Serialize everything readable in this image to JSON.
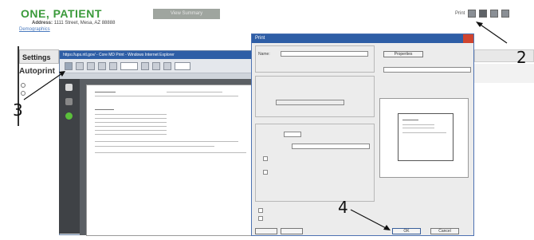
{
  "header": {
    "patient_name": "ONE, PATIENT",
    "view_summary": "View Summary",
    "print_label": "Print",
    "address": "1111 Street, Mesa, AZ 88888",
    "demographics_link": "Demographics"
  },
  "left_panel": {
    "settings_tab": "Settings",
    "autoprint_title": "Autoprint"
  },
  "pdf_viewer": {
    "title": "https://ups.ntl.gov/ - Core MD Print - Windows Internet Explorer"
  },
  "print_dialog": {
    "title": "Print",
    "properties_button": "Properties",
    "ok_button": "OK",
    "cancel_button": "Cancel"
  },
  "callouts": {
    "c2": "2",
    "c3": "3",
    "c4": "4"
  },
  "colors": {
    "patient_green": "#3a9a3a",
    "titlebar_blue": "#2e5ea6",
    "link_blue": "#4a7abf"
  }
}
